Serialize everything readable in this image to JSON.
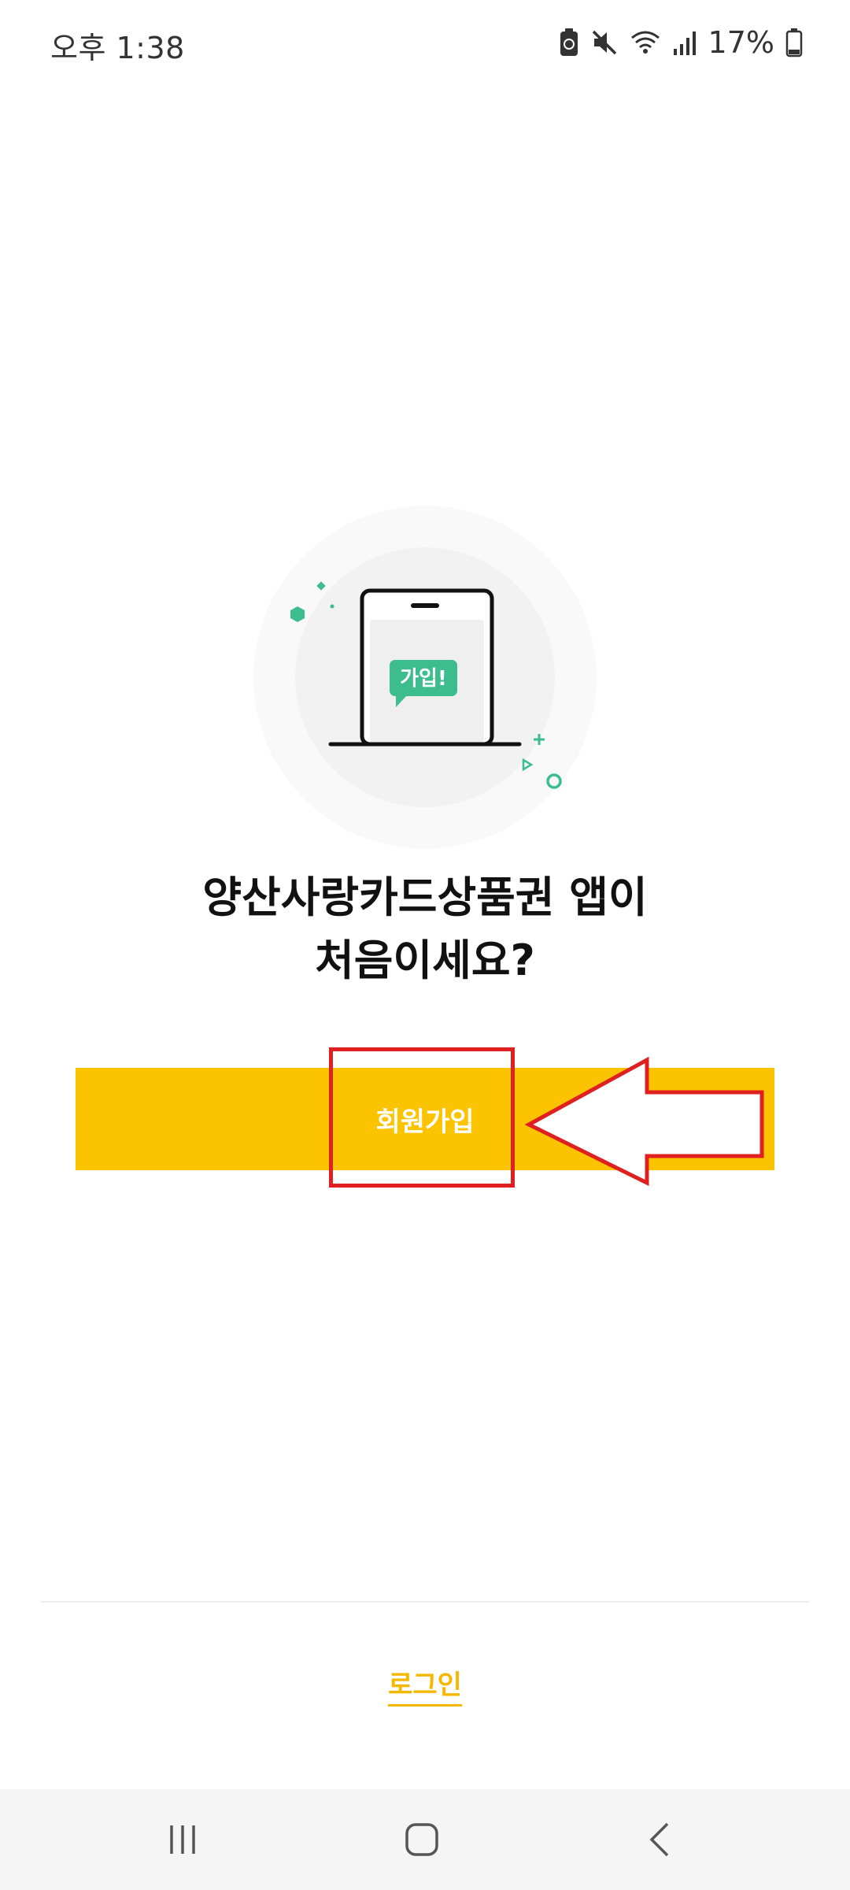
{
  "status_bar": {
    "time": "오후 1:38",
    "battery_percent": "17%",
    "icons": [
      "battery-saver-icon",
      "mute-icon",
      "wifi-icon",
      "signal-icon",
      "battery-icon"
    ]
  },
  "illustration": {
    "speech_bubble_text": "가입!",
    "accent_color": "#3dbd8d"
  },
  "heading": {
    "line1": "양산사랑카드상품권 앱이",
    "line2": "처음이세요?"
  },
  "signup": {
    "label": "회원가입",
    "color": "#fcc300"
  },
  "annotation": {
    "color": "#e02020"
  },
  "login": {
    "label": "로그인",
    "color": "#f5b800"
  },
  "nav": {
    "items": [
      "recents-icon",
      "home-icon",
      "back-icon"
    ]
  }
}
